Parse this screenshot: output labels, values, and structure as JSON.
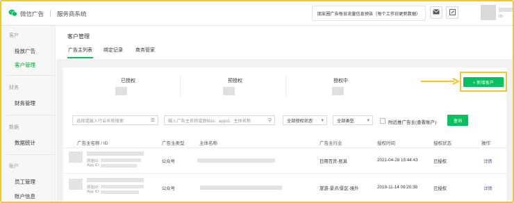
{
  "header": {
    "brand": "微信广告",
    "system": "服务商系统",
    "notice": "朋友圈广告每日流量信息预告（每个工作日更新数据）",
    "account_id_prefix": "ID:"
  },
  "sidebar": {
    "groups": [
      {
        "title": "客户",
        "items": [
          {
            "label": "投放广告",
            "active": false
          },
          {
            "label": "客户管理",
            "active": true
          }
        ]
      },
      {
        "title": "财务",
        "items": [
          {
            "label": "财务管理",
            "active": false
          }
        ]
      },
      {
        "title": "数据",
        "items": [
          {
            "label": "数据统计",
            "active": false
          }
        ]
      },
      {
        "title": "账户",
        "items": [
          {
            "label": "员工管理",
            "active": false
          },
          {
            "label": "账户信息",
            "active": false
          }
        ]
      }
    ]
  },
  "main": {
    "title": "客户管理",
    "tabs": [
      "广告主列表",
      "绑定记录",
      "商务管家"
    ],
    "active_tab": 0
  },
  "stats": [
    {
      "label": "已授权"
    },
    {
      "label": "预授权"
    },
    {
      "label": "授权中"
    }
  ],
  "add_button": "+ 新增客户",
  "filters": {
    "industry_placeholder": "选择或输入行业名称搜索",
    "search_placeholder": "输入广告主名称或原始id、appid、主体名称",
    "auth_status": "全部授权状态",
    "type": "全部类型",
    "checkbox_label": "附近推广告主(查看账户)",
    "query_button": "查询"
  },
  "table": {
    "columns": [
      "广告主名称 / ID",
      "广告主类型",
      "主体名称",
      "广告主行业",
      "授权时间",
      "授权状态",
      "操作"
    ],
    "rows": [
      {
        "orig_prefix": "原始ID:",
        "appid_prefix": "App ID:",
        "type": "公众号",
        "industry": "日用百货-居具",
        "time": "2021-04-28 15:44:43",
        "status": "已授权",
        "action": "详情"
      },
      {
        "orig_prefix": "原始ID:",
        "appid_prefix": "App ID:",
        "type": "公众号",
        "industry": "旅游-景点/景区-境外",
        "time": "2019-11-14 09:20:38",
        "status": "已授权",
        "action": "详情"
      }
    ]
  },
  "colors": {
    "accent": "#07c160",
    "highlight": "#f2c62f",
    "link": "#576b95"
  }
}
